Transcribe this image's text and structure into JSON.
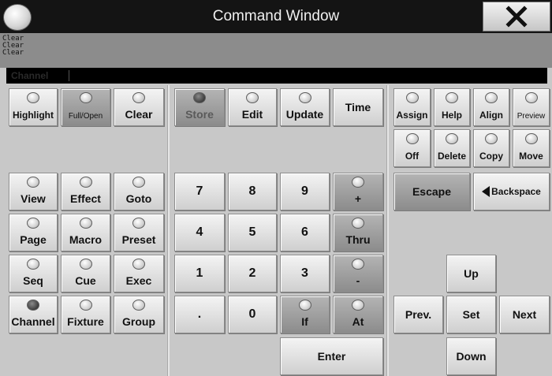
{
  "window": {
    "title": "Command Window"
  },
  "log": {
    "lines": [
      "Clear",
      "Clear",
      "Clear"
    ]
  },
  "command_line": {
    "label": "Channel"
  },
  "keys": {
    "highlight": "Highlight",
    "full_open": "Full/Open",
    "clear": "Clear",
    "store": "Store",
    "edit": "Edit",
    "update": "Update",
    "time": "Time",
    "assign": "Assign",
    "help": "Help",
    "align": "Align",
    "preview": "Preview",
    "off": "Off",
    "delete": "Delete",
    "copy": "Copy",
    "move": "Move",
    "view": "View",
    "effect": "Effect",
    "goto": "Goto",
    "page": "Page",
    "macro": "Macro",
    "preset": "Preset",
    "seq": "Seq",
    "cue": "Cue",
    "exec": "Exec",
    "channel": "Channel",
    "fixture": "Fixture",
    "group": "Group",
    "n7": "7",
    "n8": "8",
    "n9": "9",
    "plus": "+",
    "n4": "4",
    "n5": "5",
    "n6": "6",
    "thru": "Thru",
    "n1": "1",
    "n2": "2",
    "n3": "3",
    "minus": "-",
    "dot": ".",
    "n0": "0",
    "if": "If",
    "at": "At",
    "enter": "Enter",
    "escape": "Escape",
    "backspace": "Backspace",
    "up": "Up",
    "prev": "Prev.",
    "set": "Set",
    "next": "Next",
    "down": "Down"
  }
}
